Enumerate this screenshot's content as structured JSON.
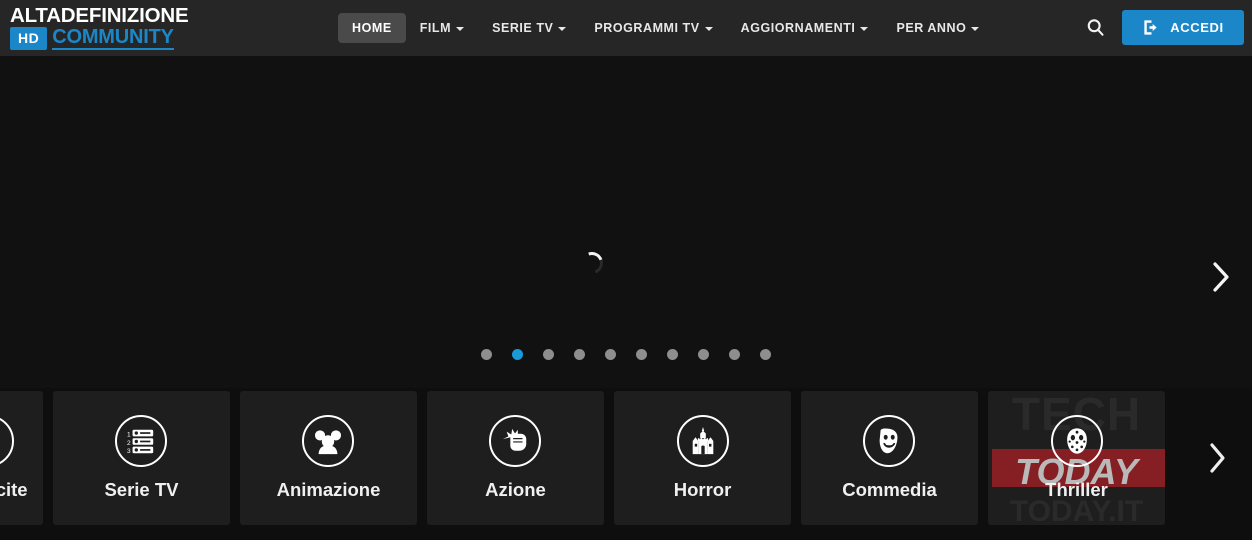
{
  "site": {
    "logo_line1": "ALTADEFINIZIONE",
    "logo_badge": "HD",
    "logo_line2": "COMMUNITY",
    "brand_blue": "#1b87c9",
    "header_bg": "#262626",
    "page_bg": "#111111",
    "card_bg": "#1e1e1e"
  },
  "header": {
    "nav": [
      {
        "label": "HOME",
        "active": true,
        "has_caret": false,
        "name": "nav-item-home"
      },
      {
        "label": "FILM",
        "active": false,
        "has_caret": true,
        "name": "nav-item-film"
      },
      {
        "label": "SERIE TV",
        "active": false,
        "has_caret": true,
        "name": "nav-item-serie-tv"
      },
      {
        "label": "PROGRAMMI TV",
        "active": false,
        "has_caret": true,
        "name": "nav-item-programmi-tv"
      },
      {
        "label": "AGGIORNAMENTI",
        "active": false,
        "has_caret": true,
        "name": "nav-item-aggiornamenti"
      },
      {
        "label": "PER ANNO",
        "active": false,
        "has_caret": true,
        "name": "nav-item-per-anno"
      }
    ],
    "search_icon": "search-icon",
    "login": {
      "label": "ACCEDI",
      "icon": "login-arrow-icon",
      "color": "#1b87c9"
    }
  },
  "hero": {
    "state": "loading",
    "spinner_icon": "loading-spinner-icon",
    "next_icon": "chevron-right-icon",
    "carousel": {
      "total_slides": 10,
      "active_index": 1,
      "active_color": "#1b9ad6",
      "inactive_color": "#8e8e8e"
    }
  },
  "categories": {
    "next_icon": "chevron-right-icon",
    "items": [
      {
        "label": "Nuove uscite",
        "visible_label": "ve uscite",
        "icon": "video-camera-icon",
        "partial": true
      },
      {
        "label": "Serie TV",
        "visible_label": "Serie TV",
        "icon": "episode-list-icon",
        "partial": false
      },
      {
        "label": "Animazione",
        "visible_label": "Animazione",
        "icon": "mouse-ears-icon",
        "partial": false
      },
      {
        "label": "Azione",
        "visible_label": "Azione",
        "icon": "fist-punch-icon",
        "partial": false
      },
      {
        "label": "Horror",
        "visible_label": "Horror",
        "icon": "haunted-castle-icon",
        "partial": false
      },
      {
        "label": "Commedia",
        "visible_label": "Commedia",
        "icon": "theater-mask-icon",
        "partial": false
      },
      {
        "label": "Thriller",
        "visible_label": "Thriller",
        "icon": "hockey-mask-icon",
        "partial": false
      }
    ]
  },
  "watermark": {
    "top_text": "TECH",
    "band_text": "TODAY",
    "bottom_text": "TODAY.IT",
    "band_color": "#8f1f25"
  }
}
